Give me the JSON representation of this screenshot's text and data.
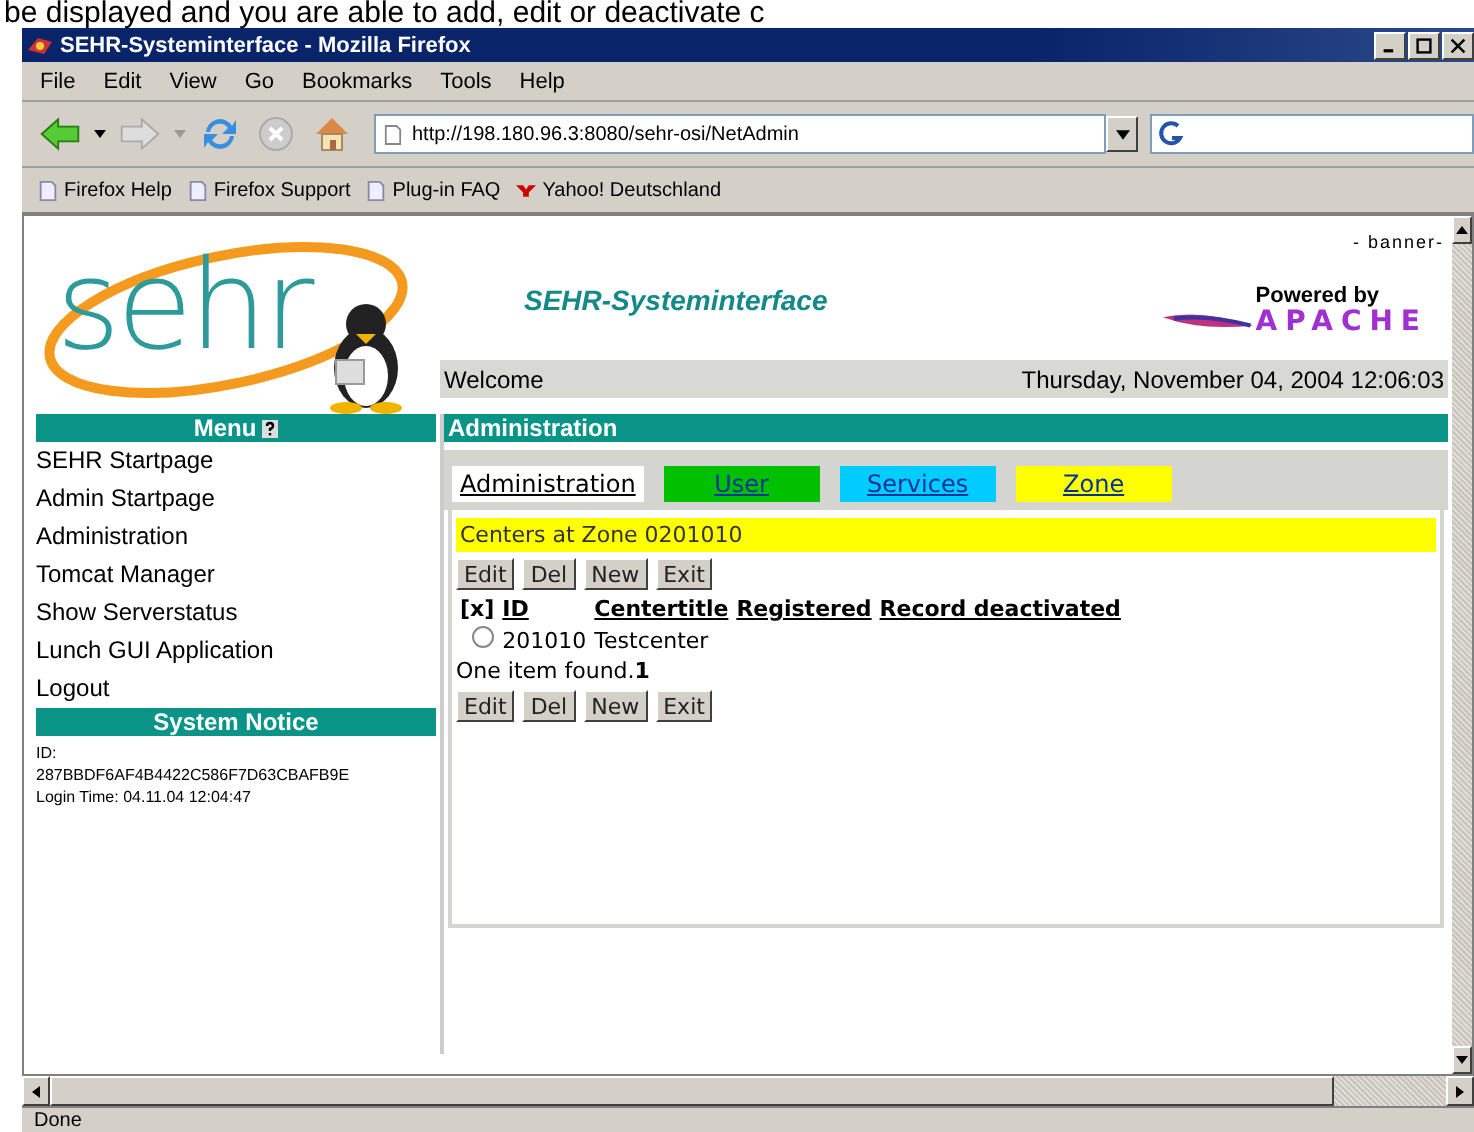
{
  "doc_caption": "be displayed and you are able to add, edit or deactivate c",
  "window": {
    "title": "SEHR-Systeminterface - Mozilla Firefox"
  },
  "menu_bar": [
    "File",
    "Edit",
    "View",
    "Go",
    "Bookmarks",
    "Tools",
    "Help"
  ],
  "address_bar": {
    "value": "http://198.180.96.3:8080/sehr-osi/NetAdmin"
  },
  "bookmarks": [
    {
      "label": "Firefox Help",
      "kind": "page"
    },
    {
      "label": "Firefox Support",
      "kind": "page"
    },
    {
      "label": "Plug-in FAQ",
      "kind": "page"
    },
    {
      "label": "Yahoo! Deutschland",
      "kind": "yahoo"
    }
  ],
  "banner": {
    "logo_text": "sehr",
    "title": "SEHR-Systeminterface",
    "label": "- banner-",
    "powered_by": "Powered by",
    "apache": "APACHE",
    "welcome": "Welcome",
    "date": "Thursday, November 04, 2004 12:06:03"
  },
  "menu": {
    "title": "Menu",
    "items": [
      "SEHR Startpage",
      "Admin Startpage",
      "Administration",
      "Tomcat Manager",
      "Show Serverstatus",
      "Lunch GUI Application",
      "Logout"
    ]
  },
  "system_notice": {
    "title": "System Notice",
    "id_label": "ID:",
    "id": "287BBDF6AF4B4422C586F7D63CBAFB9E",
    "login": "Login Time: 04.11.04 12:04:47"
  },
  "admin": {
    "title": "Administration",
    "tabs": [
      {
        "label": "Administration",
        "color": "#ffffff"
      },
      {
        "label": "User",
        "color": "#00c000"
      },
      {
        "label": "Services",
        "color": "#00ccff"
      },
      {
        "label": "Zone",
        "color": "#ffff00"
      }
    ],
    "heading": "Centers at Zone 0201010",
    "buttons_top": [
      "Edit",
      "Del",
      "New",
      "Exit"
    ],
    "columns": [
      {
        "label": "[x]",
        "underlined": false
      },
      {
        "label": "ID",
        "underlined": true
      },
      {
        "label": "Centertitle",
        "underlined": true
      },
      {
        "label": "Registered",
        "underlined": true
      },
      {
        "label": "Record deactivated",
        "underlined": true
      }
    ],
    "rows": [
      {
        "selected": false,
        "id": "201010",
        "title": "Testcenter"
      }
    ],
    "found": "One item found.**1**",
    "buttons_bottom": [
      "Edit",
      "Del",
      "New",
      "Exit"
    ]
  },
  "status_bar": "Done"
}
